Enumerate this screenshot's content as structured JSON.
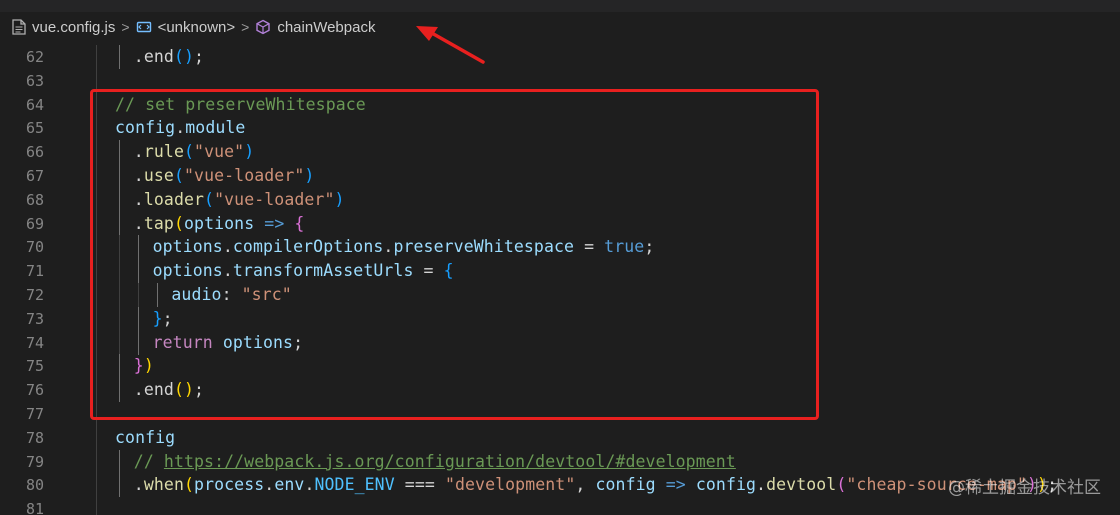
{
  "breadcrumb": {
    "file": "vue.config.js",
    "sep": ">",
    "unknown": "<unknown>",
    "symbol": "chainWebpack"
  },
  "lines": [
    {
      "no": "62",
      "indent": 2,
      "tokens": [
        [
          "",
          ".end"
        ],
        [
          "p3",
          "()"
        ],
        [
          "",
          ";"
        ]
      ]
    },
    {
      "no": "63",
      "indent": 0,
      "tokens": []
    },
    {
      "no": "64",
      "indent": 0,
      "tokens": [
        [
          "c",
          "// set preserveWhitespace"
        ]
      ]
    },
    {
      "no": "65",
      "indent": 0,
      "tokens": [
        [
          "k",
          "config"
        ],
        [
          "",
          "."
        ],
        [
          "k",
          "module"
        ]
      ]
    },
    {
      "no": "66",
      "indent": 2,
      "tokens": [
        [
          "",
          "."
        ],
        [
          "f",
          "rule"
        ],
        [
          "p3",
          "("
        ],
        [
          "s",
          "\"vue\""
        ],
        [
          "p3",
          ")"
        ]
      ]
    },
    {
      "no": "67",
      "indent": 2,
      "tokens": [
        [
          "",
          "."
        ],
        [
          "f",
          "use"
        ],
        [
          "p3",
          "("
        ],
        [
          "s",
          "\"vue-loader\""
        ],
        [
          "p3",
          ")"
        ]
      ]
    },
    {
      "no": "68",
      "indent": 2,
      "tokens": [
        [
          "",
          "."
        ],
        [
          "f",
          "loader"
        ],
        [
          "p3",
          "("
        ],
        [
          "s",
          "\"vue-loader\""
        ],
        [
          "p3",
          ")"
        ]
      ]
    },
    {
      "no": "69",
      "indent": 2,
      "tokens": [
        [
          "",
          "."
        ],
        [
          "f",
          "tap"
        ],
        [
          "p1",
          "("
        ],
        [
          "k",
          "options"
        ],
        [
          "",
          " "
        ],
        [
          "b",
          "=>"
        ],
        [
          "",
          " "
        ],
        [
          "p2",
          "{"
        ]
      ]
    },
    {
      "no": "70",
      "indent": 4,
      "tokens": [
        [
          "k",
          "options"
        ],
        [
          "",
          "."
        ],
        [
          "k",
          "compilerOptions"
        ],
        [
          "",
          "."
        ],
        [
          "k",
          "preserveWhitespace"
        ],
        [
          "",
          " = "
        ],
        [
          "b",
          "true"
        ],
        [
          "",
          ";"
        ]
      ]
    },
    {
      "no": "71",
      "indent": 4,
      "tokens": [
        [
          "k",
          "options"
        ],
        [
          "",
          "."
        ],
        [
          "k",
          "transformAssetUrls"
        ],
        [
          "",
          " = "
        ],
        [
          "p3",
          "{"
        ]
      ]
    },
    {
      "no": "72",
      "indent": 6,
      "tokens": [
        [
          "k",
          "audio"
        ],
        [
          "",
          ": "
        ],
        [
          "s",
          "\"src\""
        ]
      ]
    },
    {
      "no": "73",
      "indent": 4,
      "tokens": [
        [
          "p3",
          "}"
        ],
        [
          "",
          ";"
        ]
      ]
    },
    {
      "no": "74",
      "indent": 4,
      "tokens": [
        [
          "kw",
          "return"
        ],
        [
          "",
          " "
        ],
        [
          "k",
          "options"
        ],
        [
          "",
          ";"
        ]
      ]
    },
    {
      "no": "75",
      "indent": 2,
      "tokens": [
        [
          "p2",
          "}"
        ],
        [
          "p1",
          ")"
        ]
      ]
    },
    {
      "no": "76",
      "indent": 2,
      "tokens": [
        [
          "",
          ".end"
        ],
        [
          "p1",
          "()"
        ],
        [
          "",
          ";"
        ]
      ]
    },
    {
      "no": "77",
      "indent": 0,
      "tokens": []
    },
    {
      "no": "78",
      "indent": 0,
      "tokens": [
        [
          "k",
          "config"
        ]
      ]
    },
    {
      "no": "79",
      "indent": 2,
      "tokens": [
        [
          "c",
          "// "
        ],
        [
          "c u",
          "https://webpack.js.org/configuration/devtool/#development"
        ]
      ]
    },
    {
      "no": "80",
      "indent": 2,
      "tokens": [
        [
          "",
          "."
        ],
        [
          "f",
          "when"
        ],
        [
          "p1",
          "("
        ],
        [
          "k",
          "process"
        ],
        [
          "",
          "."
        ],
        [
          "k",
          "env"
        ],
        [
          "",
          "."
        ],
        [
          "n",
          "NODE_ENV"
        ],
        [
          "",
          " === "
        ],
        [
          "s",
          "\"development\""
        ],
        [
          "",
          ", "
        ],
        [
          "k",
          "config"
        ],
        [
          "",
          " "
        ],
        [
          "b",
          "=>"
        ],
        [
          "",
          " "
        ],
        [
          "k",
          "config"
        ],
        [
          "",
          "."
        ],
        [
          "f",
          "devtool"
        ],
        [
          "p2",
          "("
        ],
        [
          "s",
          "\"cheap-source-map\""
        ],
        [
          "p2",
          ")"
        ],
        [
          "p1",
          ")"
        ],
        [
          "",
          ";"
        ]
      ]
    },
    {
      "no": "81",
      "indent": 0,
      "tokens": []
    }
  ],
  "watermark": "@稀土掘金技术社区",
  "colors": {
    "highlight": "#e8201f",
    "background": "#1e1e1e"
  }
}
